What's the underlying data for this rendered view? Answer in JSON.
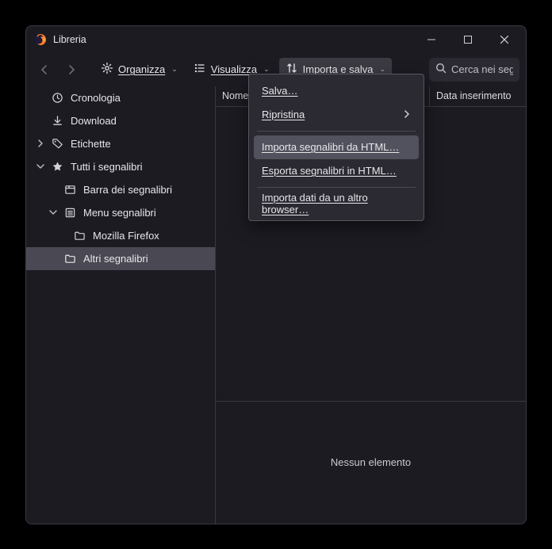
{
  "window": {
    "title": "Libreria"
  },
  "toolbar": {
    "organize": "Organizza",
    "view": "Visualizza",
    "import": "Importa e salva"
  },
  "search": {
    "placeholder": "Cerca nei segn"
  },
  "sidebar": {
    "history": "Cronologia",
    "download": "Download",
    "tags": "Etichette",
    "allBookmarks": "Tutti i segnalibri",
    "toolbarBookmarks": "Barra dei segnalibri",
    "menuBookmarks": "Menu segnalibri",
    "mozilla": "Mozilla Firefox",
    "other": "Altri segnalibri"
  },
  "columns": {
    "name": "Nome",
    "dateAdded": "Data inserimento"
  },
  "details": {
    "empty": "Nessun elemento"
  },
  "menu": {
    "save": "Salva…",
    "restore": "Ripristina",
    "importHTML": "Importa segnalibri da HTML…",
    "exportHTML": "Esporta segnalibri in HTML…",
    "importBrowser": "Importa dati da un altro browser…"
  }
}
